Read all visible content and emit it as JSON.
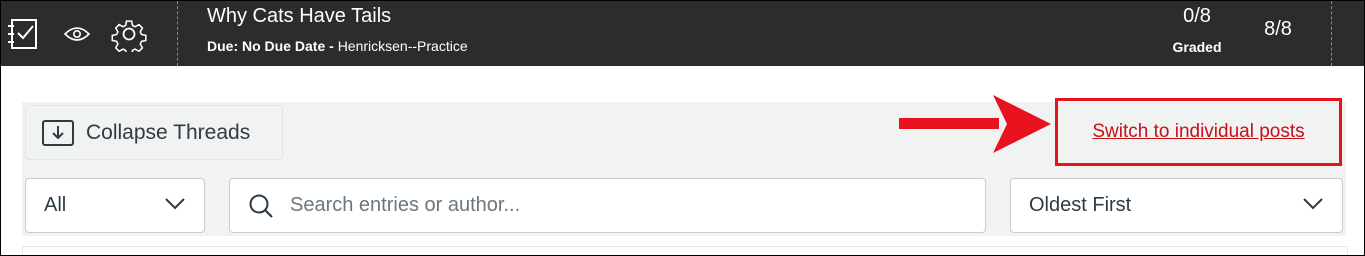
{
  "header": {
    "title": "Why Cats Have Tails",
    "due_label": "Due: No Due Date - ",
    "course": "Henricksen--Practice",
    "score": "0/8",
    "graded_label": "Graded",
    "total": "8/8",
    "icons": [
      "rubric-icon",
      "eye-icon",
      "gear-icon"
    ]
  },
  "toolbar": {
    "collapse_label": "Collapse Threads",
    "switch_link": "Switch to individual posts",
    "filter_value": "All",
    "search_placeholder": "Search entries or author...",
    "sort_value": "Oldest First"
  },
  "colors": {
    "header_bg": "#2d2b2b",
    "highlight_red": "#e8111e",
    "link_red": "#c5111a",
    "toolbar_bg": "#f1f2f2"
  }
}
